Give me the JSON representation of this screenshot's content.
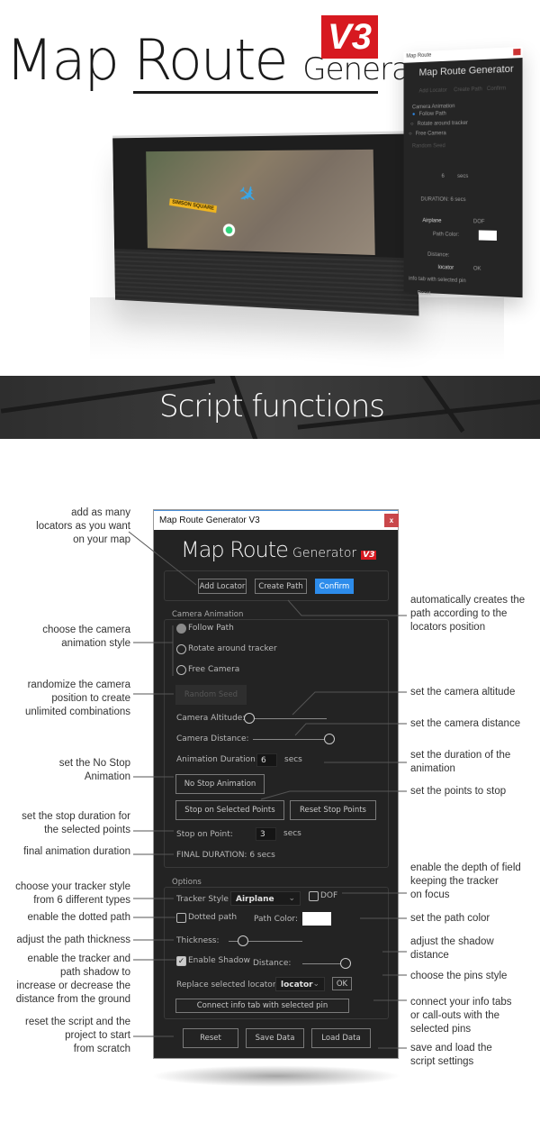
{
  "hero": {
    "logo_main": "Map Route",
    "logo_generator": "Generator",
    "logo_version": "V3",
    "map_label": "SIMSON SQUARE",
    "mini_panel": {
      "title": "Map Route",
      "logo": "Map Route Generator",
      "buttons": [
        "Add Locator",
        "Create Path",
        "Confirm"
      ],
      "group": "Camera Animation",
      "radios": [
        "Follow Path",
        "Rotate around tracker",
        "Free Camera"
      ],
      "random_seed": "Random Seed",
      "duration_value": "6",
      "secs": "secs",
      "final": "DURATION: 6 secs",
      "tracker": "Airplane",
      "dof": "DOF",
      "path_color": "Path Color:",
      "distance": "Distance:",
      "locator": "locator",
      "ok": "OK",
      "connect": "info tab with selected pin",
      "reset": "Reset"
    }
  },
  "banner": {
    "title": "Script functions"
  },
  "panel": {
    "title": "Map Route Generator V3",
    "close": "x",
    "logo_main": "Map Route",
    "logo_generator": "Generator",
    "logo_version": "V3",
    "add_locator": "Add Locator",
    "create_path": "Create Path",
    "confirm": "Confirm",
    "accent_color": "#2d8ceb",
    "camera_group": "Camera Animation",
    "radios": [
      {
        "label": "Follow Path",
        "selected": true
      },
      {
        "label": "Rotate around tracker",
        "selected": false
      },
      {
        "label": "Free Camera",
        "selected": false
      }
    ],
    "random_seed": "Random Seed",
    "camera_altitude": {
      "label": "Camera Altitude:",
      "value": 0
    },
    "camera_distance": {
      "label": "Camera Distance:",
      "value": 100
    },
    "animation_duration": {
      "label": "Animation Duration:",
      "value": "6",
      "unit": "secs"
    },
    "no_stop_animation": "No Stop Animation",
    "stop_on_selected_points": "Stop on Selected Points",
    "reset_stop_points": "Reset Stop Points",
    "stop_on_point": {
      "label": "Stop on Point:",
      "value": "3",
      "unit": "secs"
    },
    "final_duration": "FINAL DURATION: 6 secs",
    "options_group": "Options",
    "tracker_style": {
      "label": "Tracker Style",
      "value": "Airplane"
    },
    "dof": {
      "label": "DOF",
      "checked": false
    },
    "dotted_path": {
      "label": "Dotted path",
      "checked": false
    },
    "path_color": {
      "label": "Path Color:",
      "value": "#ffffff"
    },
    "thickness": {
      "label": "Thickness:",
      "value": 20
    },
    "enable_shadow": {
      "label": "Enable Shadow",
      "checked": true
    },
    "distance": {
      "label": "Distance:",
      "value": 100
    },
    "replace_locator": {
      "label": "Replace selected locator:",
      "value": "locator",
      "ok": "OK"
    },
    "connect_info": "Connect info tab with selected pin",
    "reset": "Reset",
    "save_data": "Save Data",
    "load_data": "Load Data"
  },
  "callouts_left": [
    "add as many\nlocators as you want\non your map",
    "choose the camera\nanimation style",
    "randomize the camera\nposition to create\nunlimited combinations",
    "set the No Stop\nAnimation",
    "set the stop duration for\nthe selected points",
    "final animation duration",
    "choose your tracker style\nfrom 6 different types",
    "enable the dotted path",
    "adjust the path thickness",
    "enable the tracker and\npath shadow to\nincrease or decrease the\ndistance from the ground",
    "reset the script and the\nproject to start\nfrom scratch"
  ],
  "callouts_right": [
    "automatically creates the\npath according to the\nlocators position",
    "set the camera altitude",
    "set the camera distance",
    "set the duration of the\nanimation",
    "set the points to stop",
    "enable the depth of field\nkeeping the tracker\non focus",
    "set the path color",
    "adjust the shadow\ndistance",
    "choose the pins style",
    "connect your info tabs\nor call-outs with the\nselected pins",
    "save and load the\nscript settings"
  ]
}
